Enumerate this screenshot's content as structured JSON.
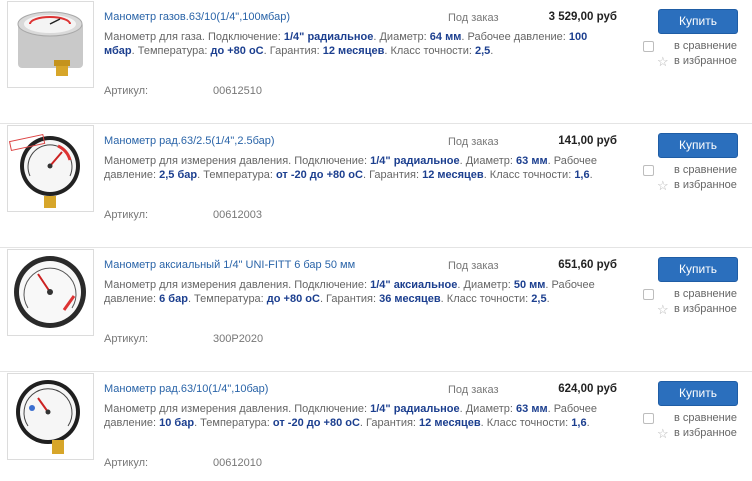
{
  "buy_label": "Купить",
  "compare_label": "в сравнение",
  "favorite_label": "в избранное",
  "article_label": "Артикул:",
  "colors": {
    "link": "#2a64a8",
    "accent": "#2b6fbd",
    "value": "#1c3f8f"
  },
  "products": [
    {
      "title": "Манометр газов.63/10(1/4\",100мбар)",
      "availability": "Под заказ",
      "price": "3 529,00 руб",
      "article": "00612510",
      "desc": [
        {
          "t": "Манометр для газа. Подключение: "
        },
        {
          "t": "1/4\" радиальное",
          "b": true
        },
        {
          "t": ". Диаметр: "
        },
        {
          "t": "64 мм",
          "b": true
        },
        {
          "t": ". Рабочее давление: "
        },
        {
          "t": "100 мбар",
          "b": true
        },
        {
          "t": ". Температура: "
        },
        {
          "t": "до +80 оС",
          "b": true
        },
        {
          "t": ". Гарантия: "
        },
        {
          "t": "12 месяцев",
          "b": true
        },
        {
          "t": ". Класс точности: "
        },
        {
          "t": "2,5",
          "b": true
        },
        {
          "t": "."
        }
      ]
    },
    {
      "title": "Манометр рад.63/2.5(1/4\",2.5бар)",
      "availability": "Под заказ",
      "price": "141,00 руб",
      "article": "00612003",
      "desc": [
        {
          "t": "Манометр для измерения давления. Подключение: "
        },
        {
          "t": "1/4\" радиальное",
          "b": true
        },
        {
          "t": ". Диаметр: "
        },
        {
          "t": "63 мм",
          "b": true
        },
        {
          "t": ". Рабочее давление: "
        },
        {
          "t": "2,5 бар",
          "b": true
        },
        {
          "t": ". Температура: "
        },
        {
          "t": "от -20 до +80 оС",
          "b": true
        },
        {
          "t": ". Гарантия: "
        },
        {
          "t": "12 месяцев",
          "b": true
        },
        {
          "t": ". Класс точности: "
        },
        {
          "t": "1,6",
          "b": true
        },
        {
          "t": "."
        }
      ]
    },
    {
      "title": "Манометр аксиальный 1/4\" UNI-FITT 6 бар 50 мм",
      "availability": "Под заказ",
      "price": "651,60 руб",
      "article": "300P2020",
      "desc": [
        {
          "t": "Манометр для измерения давления. Подключение: "
        },
        {
          "t": "1/4\" аксиальное",
          "b": true
        },
        {
          "t": ". Диаметр: "
        },
        {
          "t": "50 мм",
          "b": true
        },
        {
          "t": ". Рабочее давление: "
        },
        {
          "t": "6 бар",
          "b": true
        },
        {
          "t": ". Температура: "
        },
        {
          "t": "до +80 оС",
          "b": true
        },
        {
          "t": ". Гарантия: "
        },
        {
          "t": "36 месяцев",
          "b": true
        },
        {
          "t": ". Класс точности: "
        },
        {
          "t": "2,5",
          "b": true
        },
        {
          "t": "."
        }
      ]
    },
    {
      "title": "Манометр рад.63/10(1/4\",10бар)",
      "availability": "Под заказ",
      "price": "624,00 руб",
      "article": "00612010",
      "desc": [
        {
          "t": "Манометр для измерения давления. Подключение: "
        },
        {
          "t": "1/4\" радиальное",
          "b": true
        },
        {
          "t": ". Диаметр: "
        },
        {
          "t": "63 мм",
          "b": true
        },
        {
          "t": ". Рабочее давление: "
        },
        {
          "t": "10 бар",
          "b": true
        },
        {
          "t": ". Температура: "
        },
        {
          "t": "от -20 до +80 оС",
          "b": true
        },
        {
          "t": ". Гарантия: "
        },
        {
          "t": "12 месяцев",
          "b": true
        },
        {
          "t": ". Класс точности: "
        },
        {
          "t": "1,6",
          "b": true
        },
        {
          "t": "."
        }
      ]
    }
  ]
}
